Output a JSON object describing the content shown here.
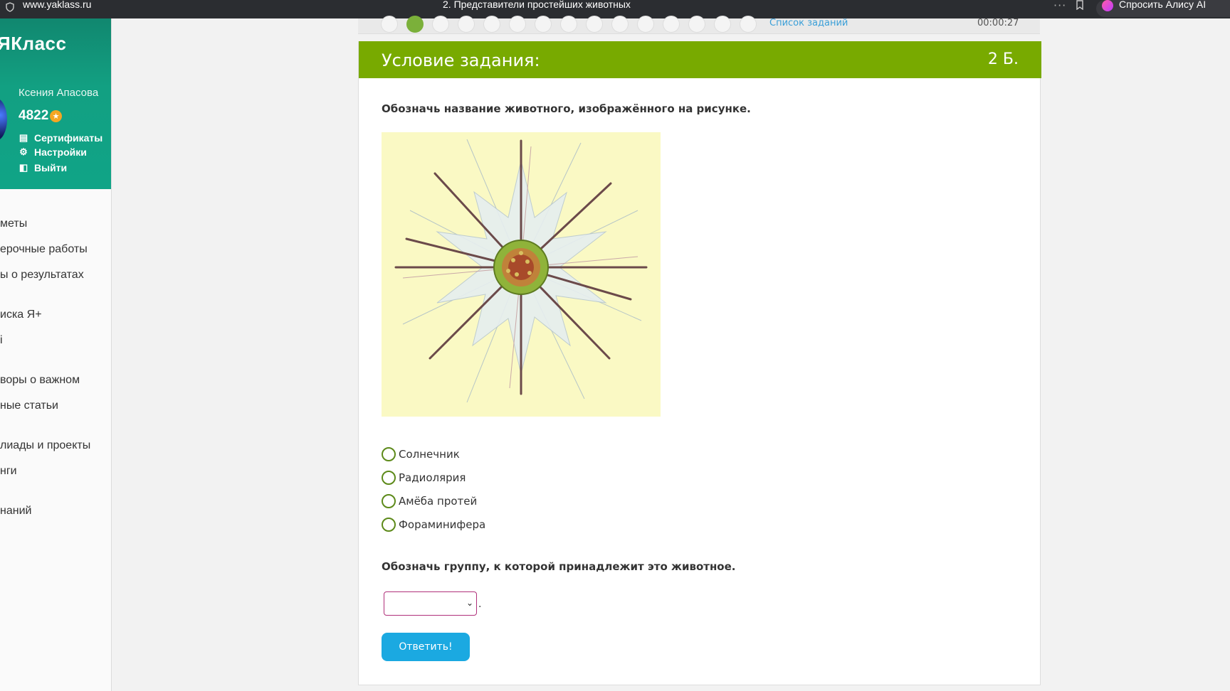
{
  "browser": {
    "url": "www.yaklass.ru",
    "tab_title": "2. Представители простейших животных",
    "alice_button": "Спросить Алису AI"
  },
  "sidebar": {
    "logo": "ЯКласс",
    "user_name": "Ксения Апасова",
    "points": "4822",
    "links": {
      "certificates": "Сертификаты",
      "settings": "Настройки",
      "logout": "Выйти"
    },
    "nav": [
      "меты",
      "ерочные работы",
      "ы о результатах",
      "иска Я+",
      "і",
      "воры о важном",
      "ные статьи",
      "лиады и проекты",
      "нги",
      "наний"
    ]
  },
  "pager": {
    "active": "2",
    "list_link": "Список заданий",
    "timer": "00:00:27"
  },
  "task": {
    "header_title": "Условие задания:",
    "score": "2 Б.",
    "question1": "Обозначь название животного, изображённого на рисунке.",
    "options": [
      "Солнечник",
      "Радиолярия",
      "Амёба протей",
      "Фораминифера"
    ],
    "question2": "Обозначь группу, к которой принадлежит это животное.",
    "select_value": "",
    "select_suffix": ".",
    "submit_label": "Ответить!"
  },
  "colors": {
    "header_green": "#78aa00",
    "sidebar_teal": "#10a487",
    "submit_blue": "#1ba9e1",
    "select_border": "#b0307a"
  }
}
